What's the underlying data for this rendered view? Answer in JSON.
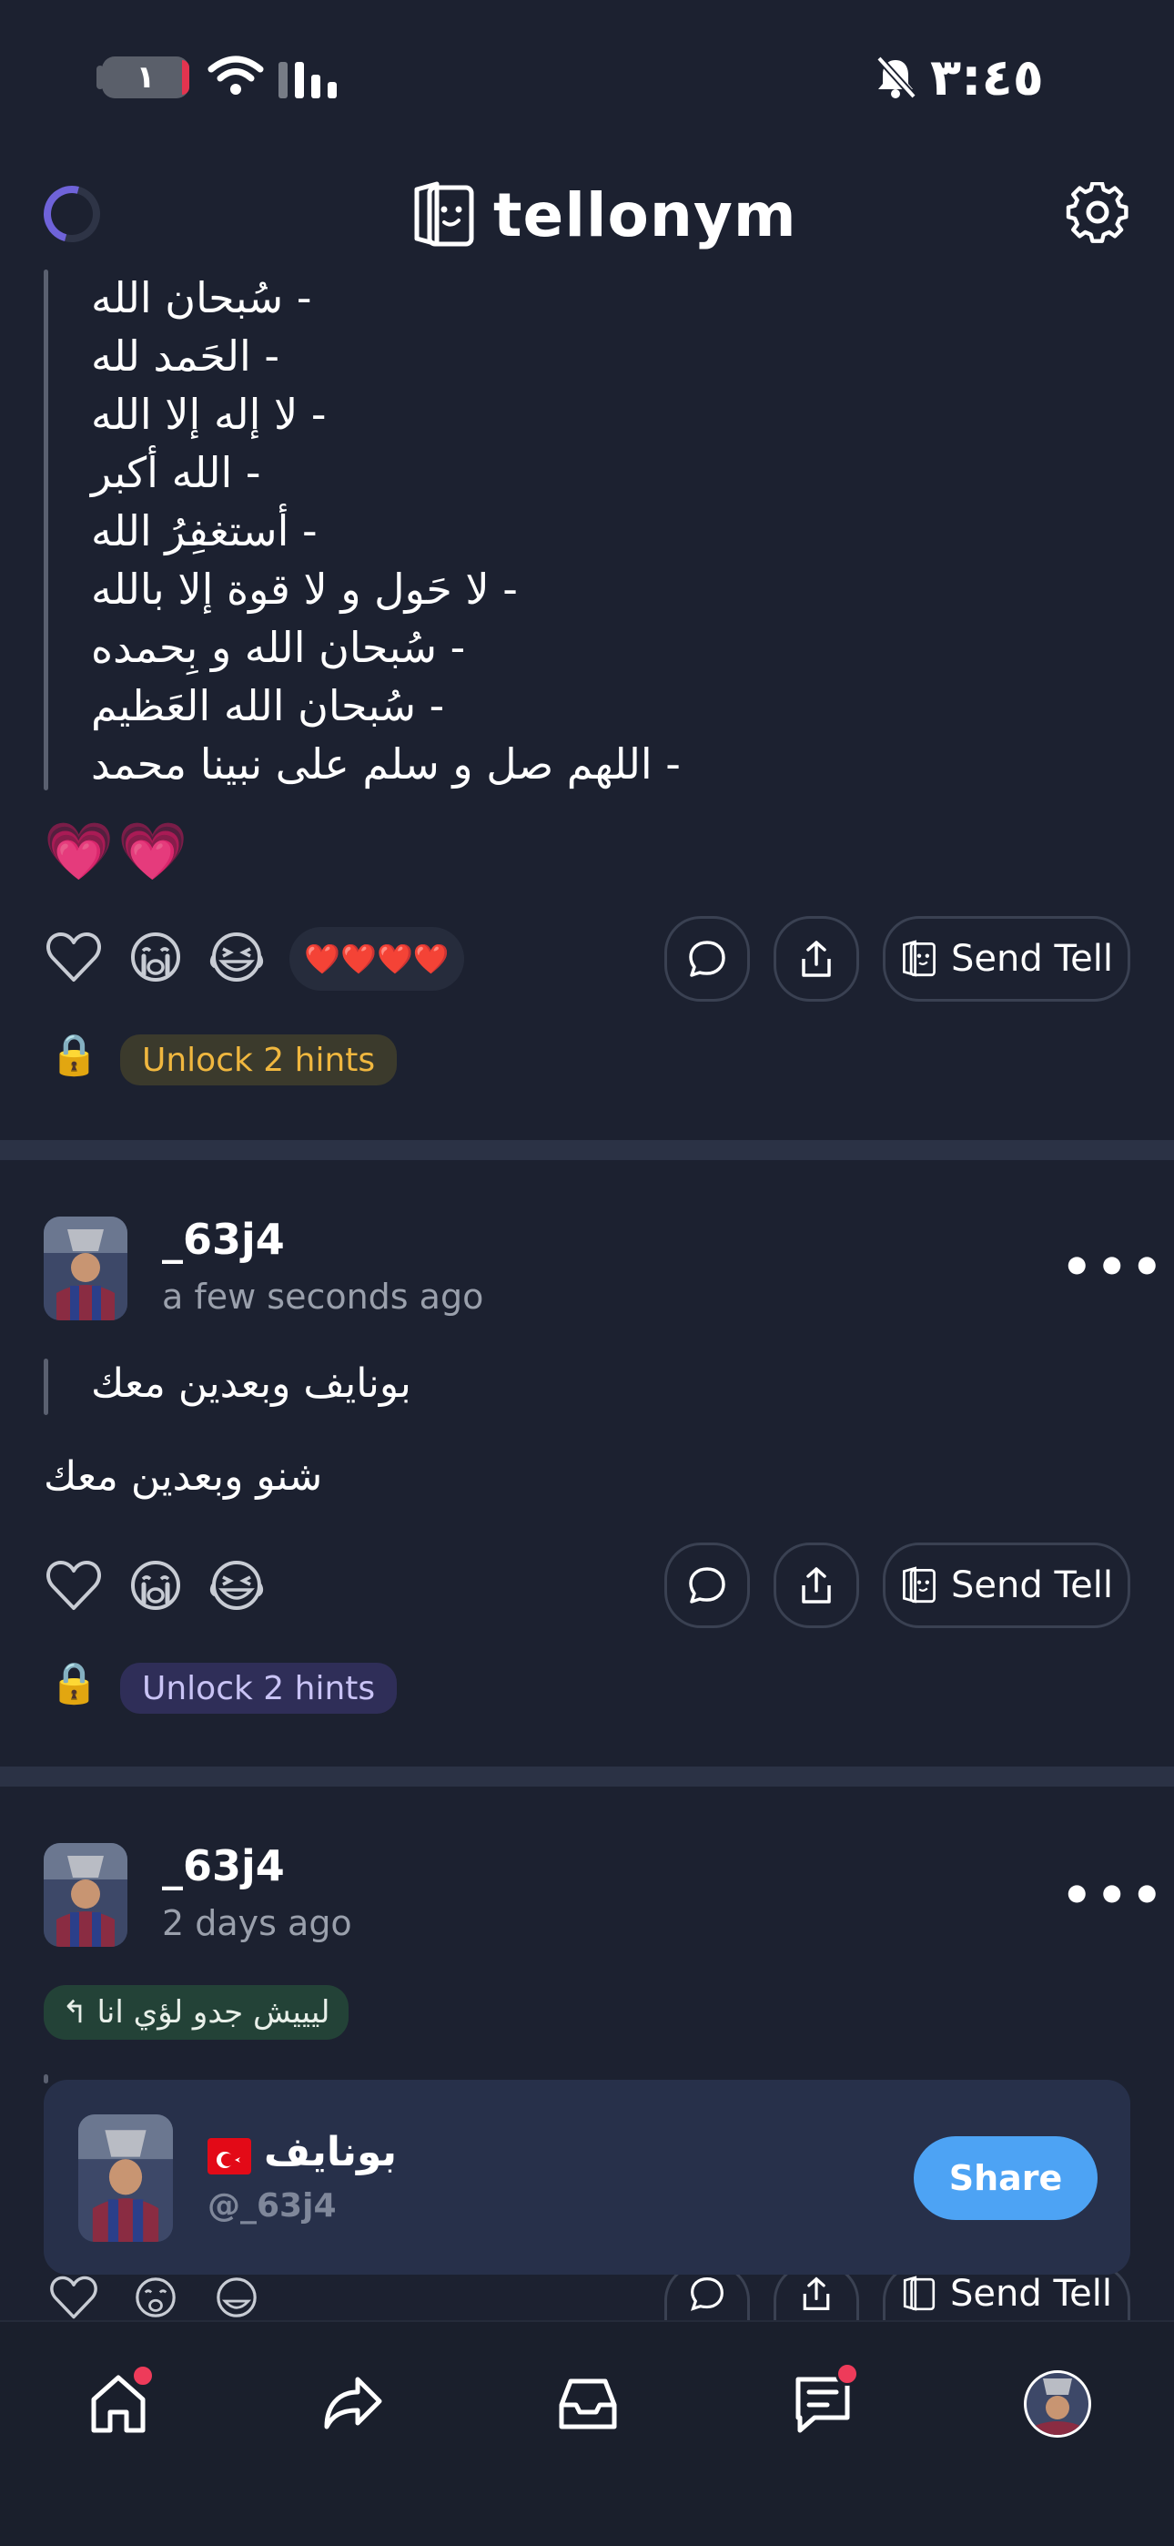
{
  "status_bar": {
    "time": "٣:٤٥",
    "battery_level": "١",
    "silent_icon": "bell-slash-icon"
  },
  "header": {
    "logo_text": "tellonym",
    "settings_icon": "gear-icon"
  },
  "post1": {
    "quote_lines": [
      "سُبحان الله -",
      "الحَمد لله -",
      "لا إله إلا الله -",
      "الله أكبر -",
      "أستغفِرُ الله -",
      "لا حَول و لا قوة إلا بالله -",
      "سُبحان الله و بِحمده -",
      "سُبحان الله العَظيم -",
      "اللهم صل و سلم على نبينا محمد -"
    ],
    "answer": "💗💗",
    "reactions_summary": "❤️❤️❤️❤️",
    "send_tell_label": "Send Tell",
    "hint_label": "Unlock 2 hints"
  },
  "post2": {
    "username": "_63j4",
    "time": "a few seconds ago",
    "question": "بونايف وبعدين معك",
    "answer": "شنو وبعدين معك",
    "send_tell_label": "Send Tell",
    "hint_label": "Unlock 2 hints"
  },
  "post3": {
    "username": "_63j4",
    "time": "2 days ago",
    "reply_chip": "ليييش جدو لؤي انا",
    "send_tell_label": "Send Tell"
  },
  "share_card": {
    "display_name": "بونايف",
    "handle": "@_63j4",
    "share_label": "Share"
  },
  "colors": {
    "background": "#1c2130",
    "accent_blue": "#4da3f4",
    "hint_gold": "#f0b73f",
    "badge_red": "#ee3b5a"
  }
}
